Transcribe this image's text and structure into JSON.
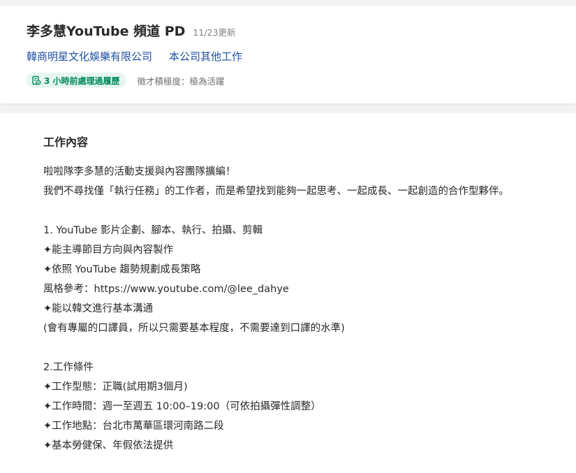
{
  "header": {
    "job_title": "李多慧YouTube 頻道 PD",
    "update_date": "11/23更新",
    "company_link": "韓商明星文化娛樂有限公司",
    "other_jobs_link": "本公司其他工作",
    "badge_text": "3 小時前處理過履歷",
    "badge_icon": "resume-processed-icon",
    "activity_text": "徵才積極度：極為活躍",
    "colors": {
      "link": "#1f4fa0",
      "badge_bg": "#e6f6ef",
      "badge_text": "#00875a"
    }
  },
  "content": {
    "section_title": "工作內容",
    "lines": [
      "啦啦隊李多慧的活動支援與內容團隊擴編！",
      "我們不尋找僅「執行任務」的工作者，而是希望找到能夠一起思考、一起成長、一起創造的合作型夥伴。",
      "",
      "1. YouTube 影片企劃、腳本、執行、拍攝、剪輯",
      "✦能主導節目方向與內容製作",
      "✦依照 YouTube 趨勢規劃成長策略",
      "風格參考：https://www.youtube.com/@lee_dahye",
      "✦能以韓文進行基本溝通",
      "(會有專屬的口譯員，所以只需要基本程度，不需要達到口譯的水準)",
      "",
      "2.工作條件",
      "✦工作型態：正職(試用期3個月)",
      "✦工作時間：週一至週五 10:00–19:00（可依拍攝彈性調整）",
      "✦工作地點：台北市萬華區環河南路二段",
      "✦基本勞健保、年假依法提供"
    ]
  }
}
